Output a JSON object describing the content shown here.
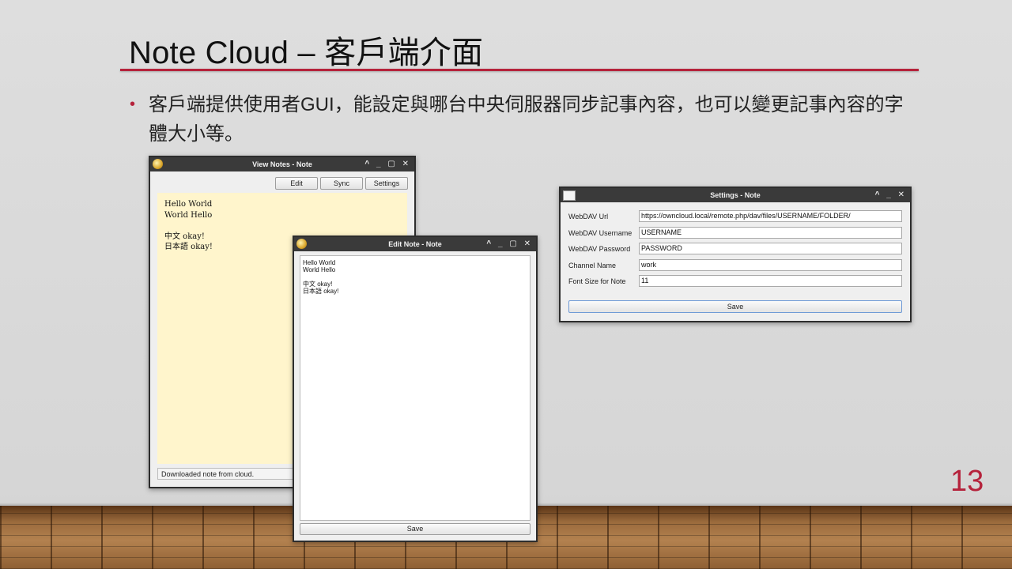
{
  "slide": {
    "title": "Note Cloud  –  客戶端介面",
    "bullet": "客戶端提供使用者GUI，能設定與哪台中央伺服器同步記事內容，也可以變更記事內容的字體大小等。",
    "page_number": "13",
    "accent_color": "#b5223b"
  },
  "view_window": {
    "title": "View Notes - Note",
    "controls": "^ _ ▢ ✕",
    "edit_label": "Edit",
    "sync_label": "Sync",
    "settings_label": "Settings",
    "lines": [
      "Hello World",
      "World Hello",
      "",
      "中文 okay!",
      "日本語 okay!"
    ],
    "status": "Downloaded note from cloud."
  },
  "edit_window": {
    "title": "Edit Note - Note",
    "controls": "^ _ ▢ ✕",
    "lines": [
      "Hello World",
      "World Hello",
      "",
      "中文 okay!",
      "日本語 okay!"
    ],
    "save_label": "Save"
  },
  "settings_window": {
    "title": "Settings - Note",
    "controls": "^ _ ✕",
    "fields": [
      {
        "label": "WebDAV Url",
        "value": "https://owncloud.local/remote.php/dav/files/USERNAME/FOLDER/"
      },
      {
        "label": "WebDAV Username",
        "value": "USERNAME"
      },
      {
        "label": "WebDAV Password",
        "value": "PASSWORD"
      },
      {
        "label": "Channel Name",
        "value": "work"
      },
      {
        "label": "Font Size for Note",
        "value": "11"
      }
    ],
    "save_label": "Save"
  }
}
